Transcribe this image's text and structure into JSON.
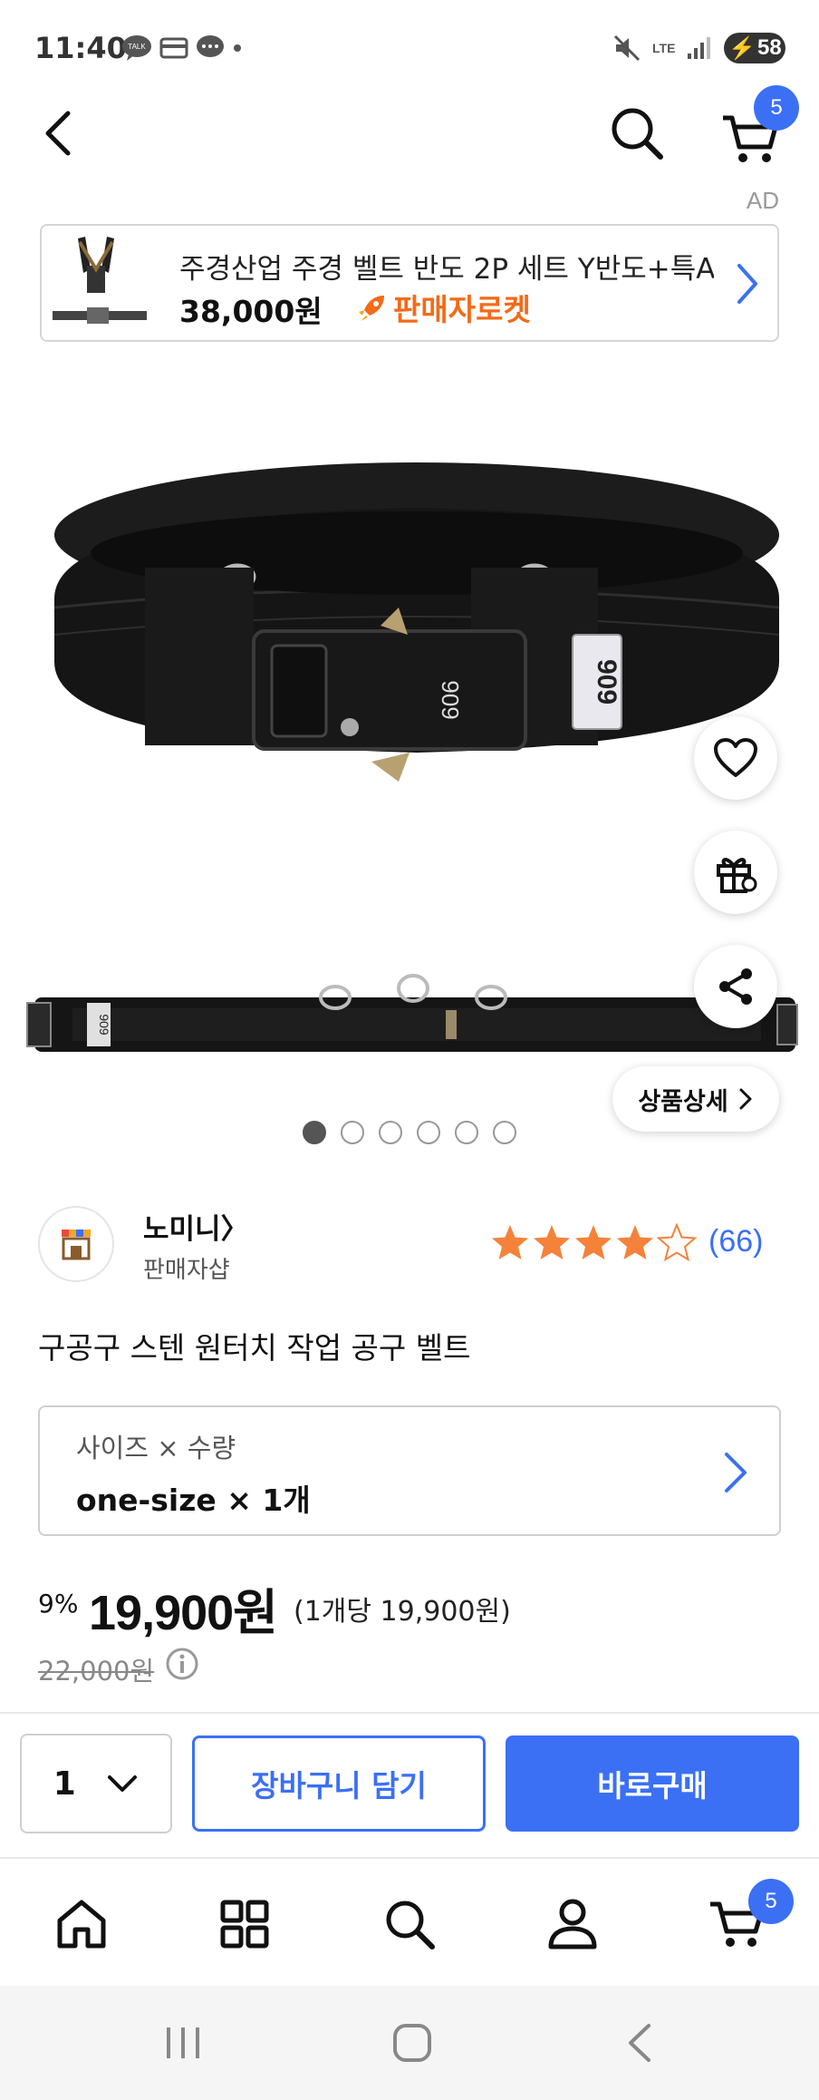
{
  "status_bar": {
    "time": "11:40",
    "network": "LTE",
    "battery": "58"
  },
  "header": {
    "cart_count": "5",
    "ad_label": "AD"
  },
  "ad_banner": {
    "title": "주경산업 주경 벨트 반도 2P 세트 Y반도+특A...",
    "price": "38,000원",
    "badge": "판매자로켓"
  },
  "product_image": {
    "brand_tag": "909",
    "detail_button": "상품상세",
    "image_count": 6,
    "active_index": 0
  },
  "seller": {
    "name": "노미니",
    "subtitle": "판매자샵",
    "rating": 4.5,
    "review_count": "(66)"
  },
  "product": {
    "title": "구공구 스텐 원터치 작업 공구 벨트"
  },
  "option": {
    "label": "사이즈 × 수량",
    "value": "one-size × 1개"
  },
  "price": {
    "discount": "9%",
    "sale_price": "19,900원",
    "unit_price": "(1개당 19,900원)",
    "original_price": "22,000원"
  },
  "actions": {
    "quantity": "1",
    "add_to_cart": "장바구니 담기",
    "buy_now": "바로구매"
  },
  "bottom_nav": {
    "cart_count": "5",
    "items": [
      "home-icon",
      "category-icon",
      "search-icon",
      "account-icon",
      "cart-icon"
    ]
  },
  "colors": {
    "accent": "#3b70f5",
    "star": "#f5823a",
    "rocket": "#f36a18"
  }
}
